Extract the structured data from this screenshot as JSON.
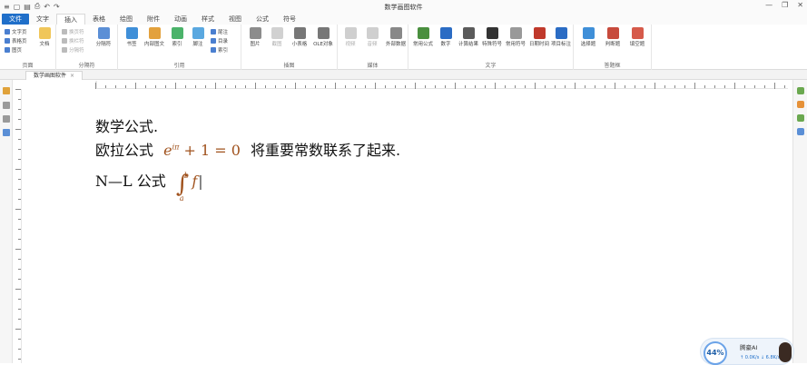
{
  "titlebar": {
    "title": "数学画图软件",
    "qat": [
      "≡",
      "▢",
      "▤",
      "⎙",
      "↶",
      "↷"
    ],
    "window_controls": [
      "—",
      "❐",
      "✕"
    ]
  },
  "tabs": [
    {
      "label": "文件",
      "kind": "file"
    },
    {
      "label": "文字",
      "kind": "normal"
    },
    {
      "label": "插入",
      "kind": "active"
    },
    {
      "label": "表格",
      "kind": "normal"
    },
    {
      "label": "绘图",
      "kind": "normal"
    },
    {
      "label": "附件",
      "kind": "normal"
    },
    {
      "label": "动画",
      "kind": "normal"
    },
    {
      "label": "样式",
      "kind": "normal"
    },
    {
      "label": "视图",
      "kind": "normal"
    },
    {
      "label": "公式",
      "kind": "normal"
    },
    {
      "label": "符号",
      "kind": "normal"
    }
  ],
  "ribbon": {
    "page_group": {
      "label": "页面",
      "items": [
        "文字页",
        "表格页",
        "图页",
        "文档"
      ]
    },
    "break_group": {
      "label": "分隔符",
      "items": [
        "换页符",
        "换栏符",
        "分隔符",
        "分隔符"
      ]
    },
    "ref_group": {
      "label": "引用",
      "items": [
        "书签",
        "内部图文",
        "索引",
        "脚注",
        "尾注",
        "目录",
        "索引"
      ]
    },
    "insert_group": {
      "label": "插图",
      "items": [
        "图片",
        "截图",
        "小表格",
        "OLE对象"
      ]
    },
    "media_group": {
      "label": "媒体",
      "items": [
        "视频",
        "音频",
        "外部数据"
      ]
    },
    "text_group": {
      "label": "文字",
      "items": [
        "常用公式",
        "数字",
        "计算结果",
        "特殊符号",
        "常用符号",
        "日期时间",
        "项目标注"
      ]
    },
    "review_group": {
      "label": "答题框",
      "items": [
        "选择题",
        "判断题",
        "填空题"
      ]
    }
  },
  "doc_tab": {
    "label": "数学画图软件",
    "close": "×"
  },
  "document": {
    "line1": "数学公式.",
    "line2_prefix": "欧拉公式",
    "euler_base": "e",
    "euler_exp": "iπ",
    "euler_rest": "+ 1 = 0",
    "line2_suffix": "将重要常数联系了起来.",
    "line3_prefix": "N—L 公式",
    "integral_upper": "b",
    "integral_lower": "a",
    "integrand": "f",
    "cursor_glyph": "|"
  },
  "ai_widget": {
    "percent": "44%",
    "title": "腾豪AI",
    "speeds": "↑ 0.0K/s  ↓ 6.8K/s"
  },
  "colors": {
    "accent": "#1f6fc9",
    "ribbon_bg": "#ffffff",
    "titlebar_bg": "#fafafa"
  }
}
